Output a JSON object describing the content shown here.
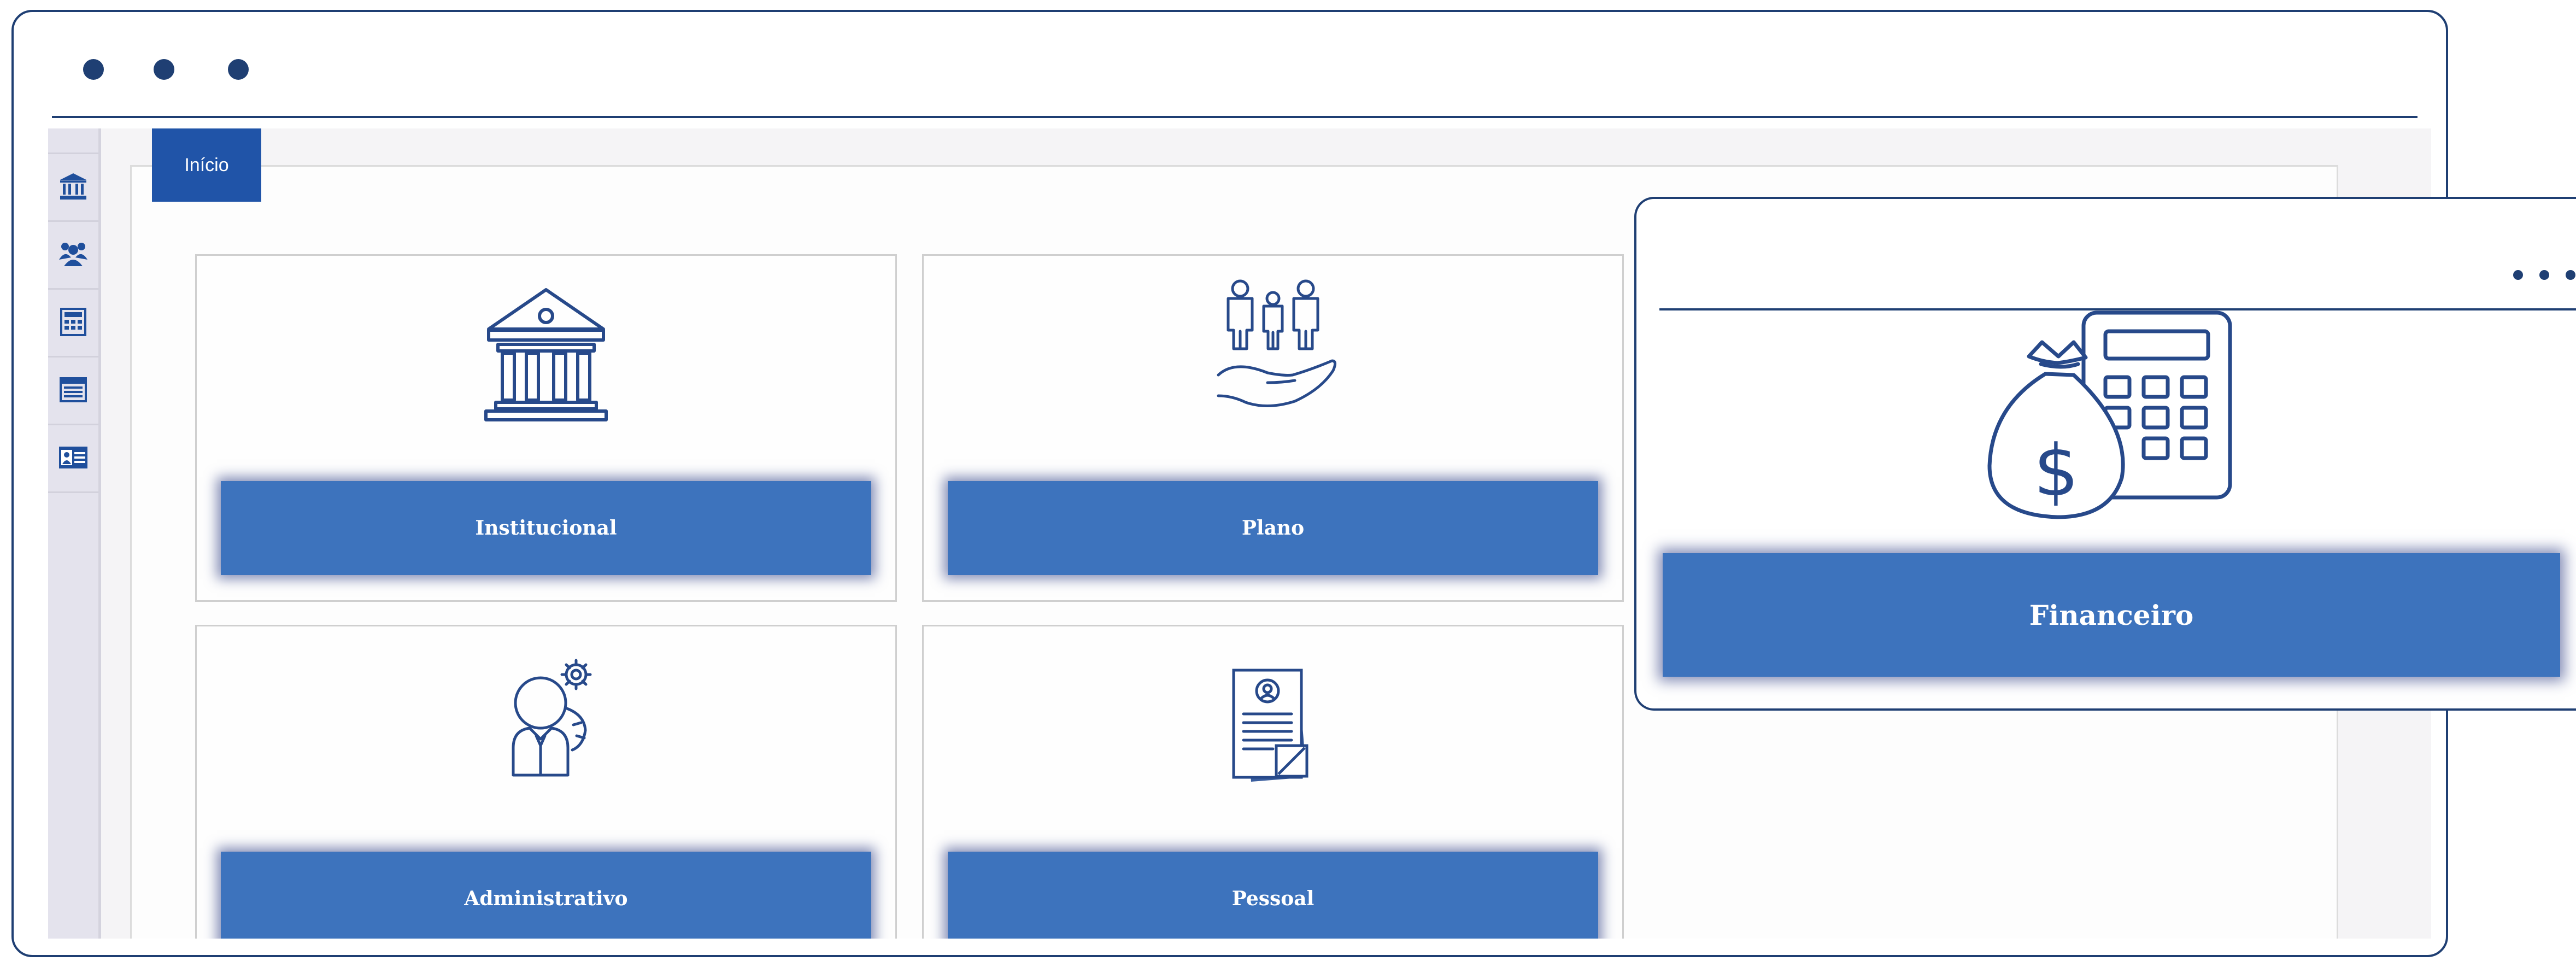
{
  "colors": {
    "frame": "#1f3f73",
    "tab_bg": "#2054a8",
    "button_bg": "#3d73bd",
    "icon_stroke": "#27498a",
    "sidebar_bg": "#e4e3ed"
  },
  "sidebar": {
    "items": [
      {
        "icon": "home-icon"
      },
      {
        "icon": "institution-icon"
      },
      {
        "icon": "people-icon"
      },
      {
        "icon": "calculator-icon"
      },
      {
        "icon": "list-icon"
      },
      {
        "icon": "id-card-icon"
      }
    ]
  },
  "tab": {
    "label": "Início"
  },
  "cards": [
    {
      "label": "Institucional",
      "icon": "institution-building-icon"
    },
    {
      "label": "Plano",
      "icon": "family-hand-icon"
    },
    {
      "label": "Administrativo",
      "icon": "administrator-gear-icon"
    },
    {
      "label": "Pessoal",
      "icon": "personnel-documents-icon"
    }
  ],
  "popup": {
    "label": "Financeiro",
    "icon": "money-bag-calculator-icon"
  }
}
